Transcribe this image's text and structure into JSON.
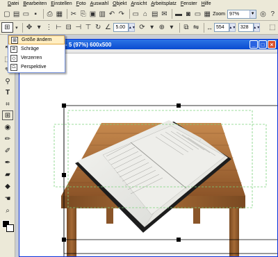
{
  "menubar": {
    "items": [
      "Datei",
      "Bearbeiten",
      "Einstellen",
      "Foto",
      "Auswahl",
      "Objekt",
      "Ansicht",
      "Arbeitsplatz",
      "Fenster",
      "Hilfe"
    ]
  },
  "toolbar": {
    "zoom_label": "Zoom",
    "zoom_value": "97%"
  },
  "property_bar": {
    "spin_value": "5.00",
    "width_value": "554",
    "height_value": "328"
  },
  "transform_menu": {
    "items": [
      {
        "label": "Größe ändern",
        "icon": "resize-icon",
        "selected": true
      },
      {
        "label": "Schräge",
        "icon": "skew-icon",
        "selected": false
      },
      {
        "label": "Verzerren",
        "icon": "distort-icon",
        "selected": false
      },
      {
        "label": "Perspektive",
        "icon": "perspective-icon",
        "selected": false
      }
    ]
  },
  "document": {
    "title": "- 5 (97%) 600x500"
  },
  "colors": {
    "titlebar": "#0a4bd0",
    "accent_highlight": "#ffeec2",
    "selection_guide": "#7cd27c"
  }
}
